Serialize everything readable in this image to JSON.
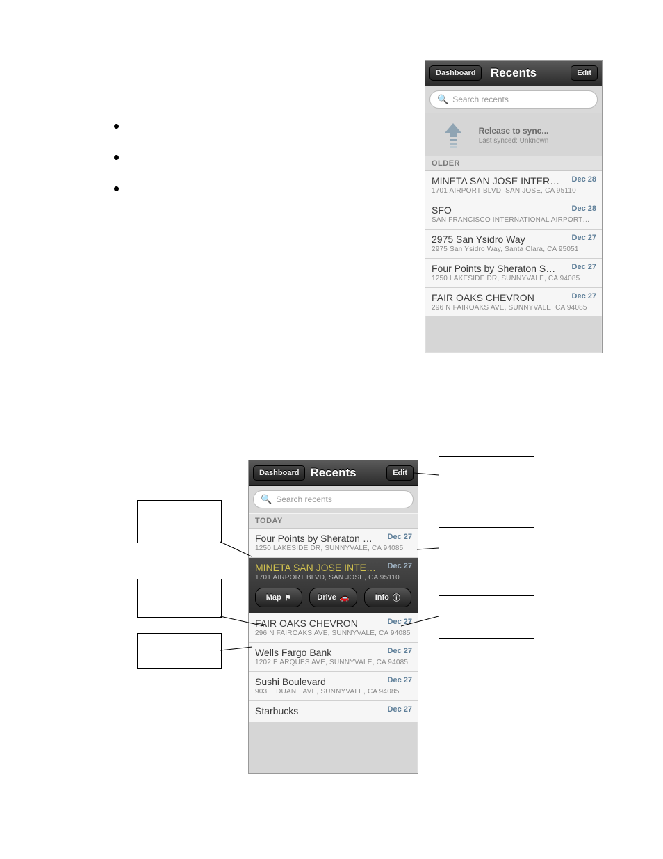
{
  "bullets": {
    "count": 3
  },
  "phone1": {
    "nav": {
      "back": "Dashboard",
      "title": "Recents",
      "edit": "Edit"
    },
    "search_placeholder": "Search recents",
    "sync": {
      "line1": "Release to sync...",
      "line2": "Last synced: Unknown"
    },
    "section": "OLDER",
    "rows": [
      {
        "title": "MINETA SAN JOSE INTER…",
        "sub": "1701 AIRPORT BLVD, SAN JOSE, CA 95110",
        "date": "Dec 28"
      },
      {
        "title": "SFO",
        "sub": "SAN FRANCISCO INTERNATIONAL AIRPORT…",
        "date": "Dec 28"
      },
      {
        "title": "2975 San Ysidro Way",
        "sub": "2975 San Ysidro Way, Santa Clara, CA 95051",
        "date": "Dec 27"
      },
      {
        "title": "Four Points by Sheraton S…",
        "sub": "1250 LAKESIDE DR, SUNNYVALE, CA 94085",
        "date": "Dec 27"
      },
      {
        "title": "FAIR OAKS CHEVRON",
        "sub": "296 N FAIROAKS AVE, SUNNYVALE, CA 94085",
        "date": "Dec 27"
      }
    ]
  },
  "phone2": {
    "nav": {
      "back": "Dashboard",
      "title": "Recents",
      "edit": "Edit"
    },
    "search_placeholder": "Search recents",
    "section": "TODAY",
    "rows_before": [
      {
        "title": "Four Points by Sheraton S…",
        "sub": "1250 LAKESIDE DR, SUNNYVALE, CA 94085",
        "date": "Dec 27"
      }
    ],
    "selected": {
      "title": "MINETA SAN JOSE INTER…",
      "sub": "1701 AIRPORT BLVD, SAN JOSE, CA 95110",
      "date": "Dec 27",
      "actions": {
        "map": "Map",
        "drive": "Drive",
        "info": "Info"
      }
    },
    "rows_after": [
      {
        "title": "FAIR OAKS CHEVRON",
        "sub": "296 N FAIROAKS AVE, SUNNYVALE, CA 94085",
        "date": "Dec 27"
      },
      {
        "title": "Wells Fargo Bank",
        "sub": "1202 E ARQUES AVE, SUNNYVALE, CA 94085",
        "date": "Dec 27"
      },
      {
        "title": "Sushi Boulevard",
        "sub": "903 E DUANE AVE, SUNNYVALE, CA 94085",
        "date": "Dec 27"
      },
      {
        "title": "Starbucks",
        "sub": "",
        "date": "Dec 27"
      }
    ]
  }
}
